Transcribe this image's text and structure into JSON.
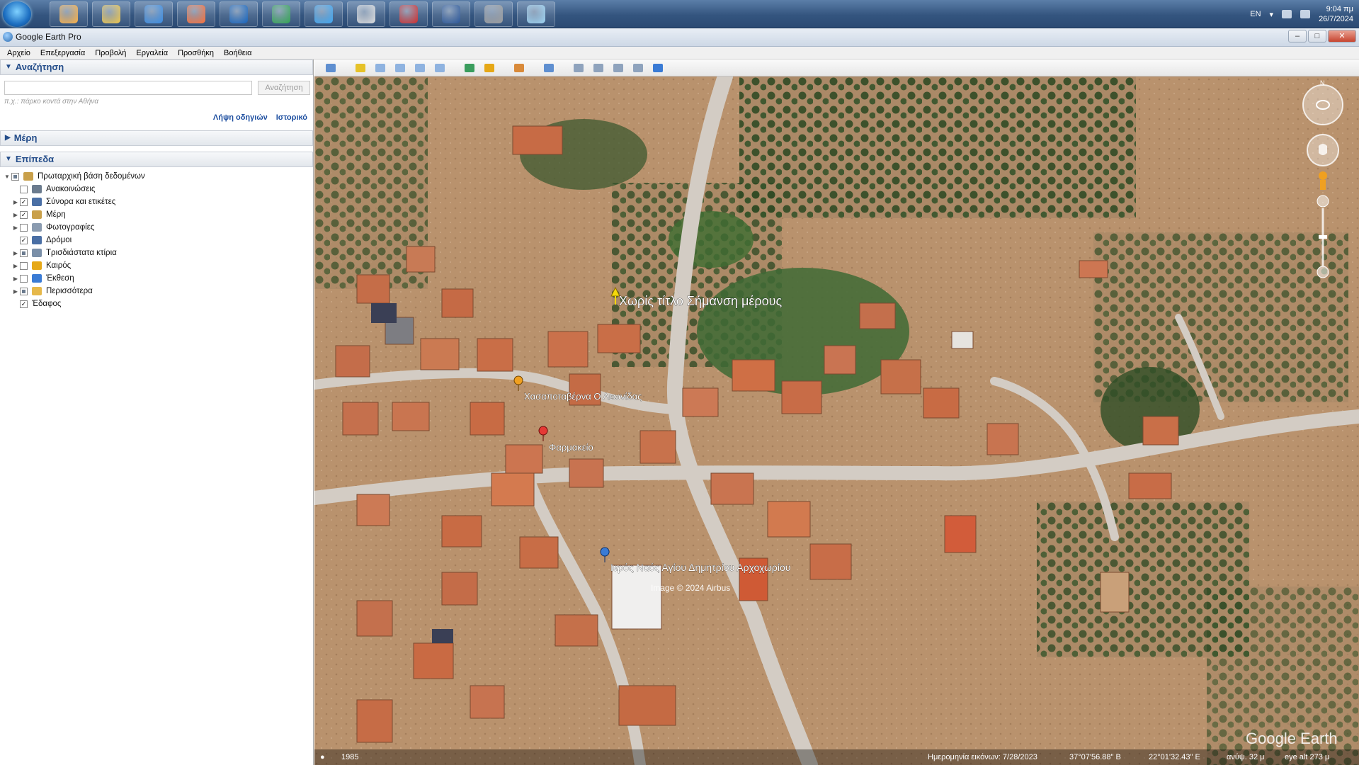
{
  "taskbar": {
    "apps": [
      {
        "name": "media-player-icon",
        "color": "#ffb347"
      },
      {
        "name": "file-explorer-icon",
        "color": "#f2c94c"
      },
      {
        "name": "internet-explorer-icon",
        "color": "#3a8ee6"
      },
      {
        "name": "firefox-icon",
        "color": "#ff7139"
      },
      {
        "name": "teamviewer-icon",
        "color": "#1565c0"
      },
      {
        "name": "chrome-icon",
        "color": "#34a853"
      },
      {
        "name": "b5-app-icon",
        "color": "#3fa9f5"
      },
      {
        "name": "pen-tool-icon",
        "color": "#e0e0e0"
      },
      {
        "name": "acrobat-icon",
        "color": "#d32f2f"
      },
      {
        "name": "word-icon",
        "color": "#2b579a"
      },
      {
        "name": "printer-icon",
        "color": "#9e9e9e"
      },
      {
        "name": "paint-icon",
        "color": "#9fd6f5"
      }
    ],
    "lang": "EN",
    "time": "9:04 πμ",
    "date": "26/7/2024"
  },
  "window": {
    "title": "Google Earth Pro"
  },
  "menu": [
    "Αρχείο",
    "Επεξεργασία",
    "Προβολή",
    "Εργαλεία",
    "Προσθήκη",
    "Βοήθεια"
  ],
  "search": {
    "header": "Αναζήτηση",
    "placeholder": "",
    "button": "Αναζήτηση",
    "hint": "π.χ.: πάρκο κοντά στην Αθήνα",
    "directions_link": "Λήψη οδηγιών",
    "history_link": "Ιστορικό"
  },
  "places": {
    "header": "Μέρη"
  },
  "layers": {
    "header": "Επίπεδα",
    "items": [
      {
        "label": "Πρωταρχική βάση δεδομένων",
        "check": "partial",
        "expand": "▼",
        "icon": "layers-icon",
        "color": "#c9a04a",
        "indent": 0
      },
      {
        "label": "Ανακοινώσεις",
        "check": "",
        "expand": "",
        "icon": "envelope-icon",
        "color": "#6b7b8e",
        "indent": 1
      },
      {
        "label": "Σύνορα και ετικέτες",
        "check": "✓",
        "expand": "▶",
        "icon": "flag-icon",
        "color": "#4a6fa5",
        "indent": 1
      },
      {
        "label": "Μέρη",
        "check": "✓",
        "expand": "▶",
        "icon": "place-icon",
        "color": "#c9a04a",
        "indent": 1
      },
      {
        "label": "Φωτογραφίες",
        "check": "",
        "expand": "▶",
        "icon": "photo-icon",
        "color": "#8a9bb0",
        "indent": 1
      },
      {
        "label": "Δρόμοι",
        "check": "✓",
        "expand": "",
        "icon": "road-icon",
        "color": "#4a6fa5",
        "indent": 1
      },
      {
        "label": "Τρισδιάστατα κτίρια",
        "check": "partial",
        "expand": "▶",
        "icon": "building-icon",
        "color": "#7a8fa8",
        "indent": 1
      },
      {
        "label": "Καιρός",
        "check": "",
        "expand": "▶",
        "icon": "weather-icon",
        "color": "#e6a817",
        "indent": 1
      },
      {
        "label": "Έκθεση",
        "check": "",
        "expand": "▶",
        "icon": "star-icon",
        "color": "#3a7bd5",
        "indent": 1
      },
      {
        "label": "Περισσότερα",
        "check": "partial",
        "expand": "▶",
        "icon": "folder-icon",
        "color": "#e6b84a",
        "indent": 1
      },
      {
        "label": "Έδαφος",
        "check": "✓",
        "expand": "",
        "icon": "",
        "color": "",
        "indent": 1
      }
    ]
  },
  "toolbar": {
    "tools": [
      {
        "name": "sidebar-toggle-icon",
        "color": "#5f8fd0"
      },
      {
        "name": "sep"
      },
      {
        "name": "add-placemark-icon",
        "color": "#e6c229"
      },
      {
        "name": "add-polygon-icon",
        "color": "#8fb3e0"
      },
      {
        "name": "add-path-icon",
        "color": "#8fb3e0"
      },
      {
        "name": "add-overlay-icon",
        "color": "#8fb3e0"
      },
      {
        "name": "record-tour-icon",
        "color": "#8fb3e0"
      },
      {
        "name": "sep"
      },
      {
        "name": "historical-imagery-icon",
        "color": "#3a9d5d"
      },
      {
        "name": "sunlight-icon",
        "color": "#e6a817"
      },
      {
        "name": "sep"
      },
      {
        "name": "planet-switch-icon",
        "color": "#d98a3a"
      },
      {
        "name": "sep"
      },
      {
        "name": "ruler-icon",
        "color": "#5f8fd0"
      },
      {
        "name": "sep"
      },
      {
        "name": "email-icon",
        "color": "#8fa3bd"
      },
      {
        "name": "print-icon",
        "color": "#8fa3bd"
      },
      {
        "name": "save-image-icon",
        "color": "#8fa3bd"
      },
      {
        "name": "movie-icon",
        "color": "#8fa3bd"
      },
      {
        "name": "maps-icon",
        "color": "#3a7bd5"
      }
    ]
  },
  "map": {
    "labels": {
      "placemark": "Χωρίς τίτλο Σήμανση μέρους",
      "restaurant": "Χασαποταβέρνα Ο Λεωνίδας",
      "pharmacy": "Φαρμακείο",
      "church": "Ιερός Ναός Αγίου Δημητρίου Αρχοχωρίου",
      "imagery": "Image © 2024 Airbus",
      "brand": "Google Earth",
      "compass_n": "N"
    }
  },
  "status": {
    "year": "1985",
    "imagery_date": "Ημερομηνία εικόνων: 7/28/2023",
    "lat": "37°07'56.88\" B",
    "lon": "22°01'32.43\" E",
    "elevation": "ανύψ. 32 μ",
    "eye_alt": "eye alt 273 μ"
  }
}
